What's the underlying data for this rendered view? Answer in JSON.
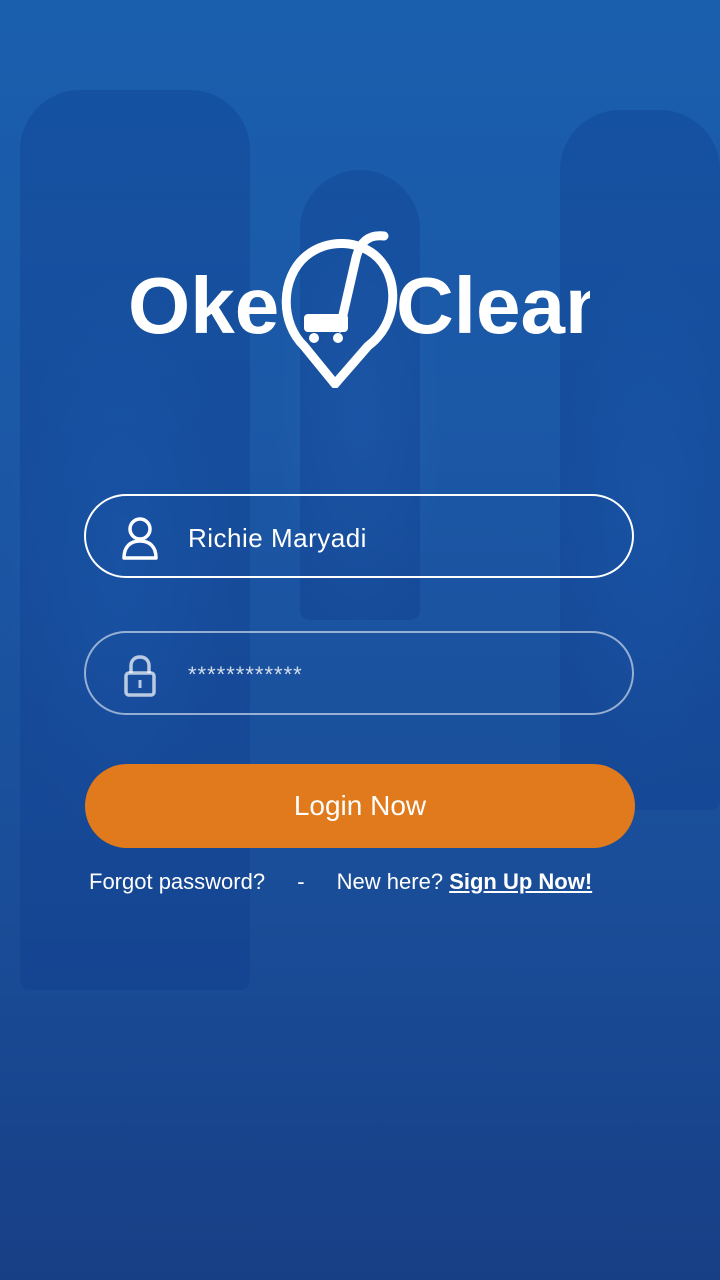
{
  "brand": {
    "left": "Oke",
    "right": "Clean"
  },
  "username": {
    "value": "Richie Maryadi"
  },
  "password": {
    "value": "************"
  },
  "login_button": "Login Now",
  "forgot_password": "Forgot password?",
  "separator": "-",
  "new_here": "New here?",
  "sign_up": "Sign Up Now!",
  "colors": {
    "primary_blue": "#1b56a4",
    "accent_orange": "#e07a1c",
    "text": "#ffffff"
  },
  "icons": {
    "user": "user-icon",
    "lock": "lock-icon",
    "logo": "vacuum-pin-logo"
  }
}
